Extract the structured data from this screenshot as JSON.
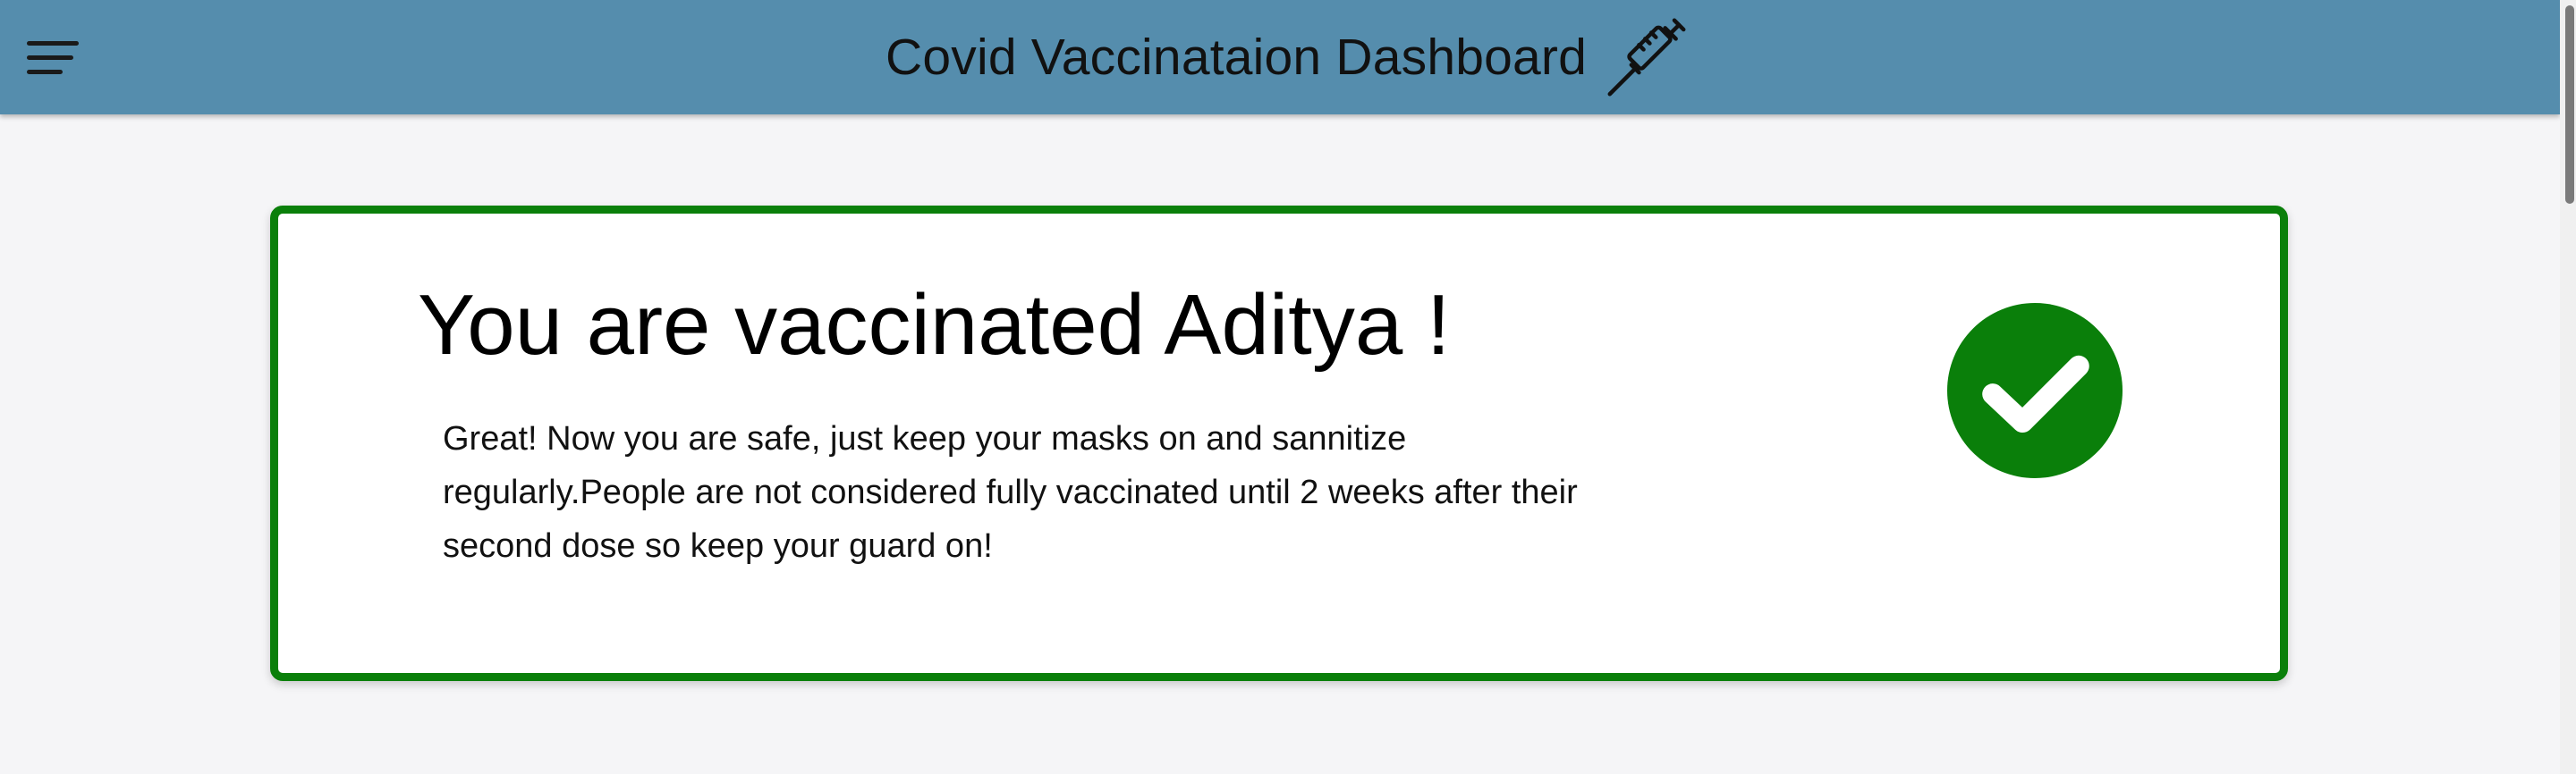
{
  "header": {
    "title": "Covid Vaccinataion Dashboard",
    "menu_icon": "hamburger-menu-icon",
    "title_icon": "syringe-icon",
    "background_color": "#558dad"
  },
  "status_card": {
    "heading": "You are vaccinated Aditya !",
    "message": "Great! Now you are safe, just keep your masks on and sannitize regularly.People are not considered fully vaccinated until 2 weeks after their second dose so keep your guard on!",
    "status_icon": "check-circle-icon",
    "accent_color": "#0a7f0a"
  }
}
